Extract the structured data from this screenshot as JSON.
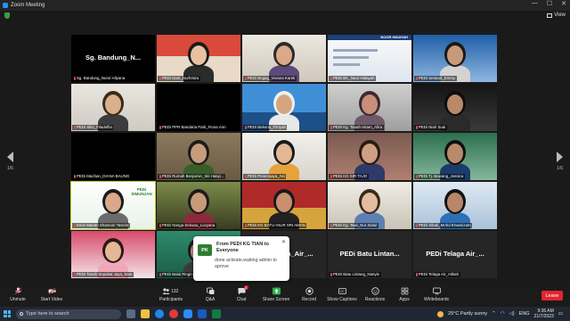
{
  "window": {
    "title": "Zoom Meeting",
    "controls": [
      "—",
      "☐",
      "✕"
    ]
  },
  "view_button": {
    "label": "View"
  },
  "pager": {
    "left": "1/6",
    "right": "1/6"
  },
  "tiles": [
    {
      "name": "Sg. Bandung_Nurul Hilyana",
      "big": "Sg. Bandung_N...",
      "muted": true,
      "video": false
    },
    {
      "name": "PEDi Darit_Nurhmira",
      "muted": true,
      "video": true
    },
    {
      "name": "PEDi Bogag_Viviana Karek",
      "muted": true,
      "video": true
    },
    {
      "name": "PEDi BC_Noor Hidayah",
      "muted": true,
      "video": true,
      "slide_title": "NOOR HIDAYAH"
    },
    {
      "name": "PEDi Serasot_Emmy",
      "muted": true,
      "video": true
    },
    {
      "name": "PEDi Sklo_Filadelfia",
      "muted": true,
      "video": true
    },
    {
      "name": "PEDi PPR Bandaria Park_Fiona Ann",
      "muted": true,
      "video": false
    },
    {
      "name": "PEDi Bekenu_Fitriyah",
      "muted": true,
      "video": true
    },
    {
      "name": "PEDi Kg. Tanah Hitam_Afira",
      "muted": true,
      "video": true
    },
    {
      "name": "PEDi Niah Suai",
      "muted": true,
      "video": true
    },
    {
      "name": "PEDi Machan_DIANA BAUNG",
      "muted": true,
      "video": false
    },
    {
      "name": "PEDi Rumah Benjamin_Siti Hasyi...",
      "muted": true,
      "video": true
    },
    {
      "name": "PEDi Pemenjaya_Asi",
      "muted": true,
      "video": true
    },
    {
      "name": "PEDi KG SIR TAJO",
      "muted": true,
      "video": true
    },
    {
      "name": "PEDi Tj. Bowang_Jessica",
      "muted": true,
      "video": true
    },
    {
      "name": "Irene Marian Shannon Tassim",
      "muted": true,
      "video": true,
      "active": true,
      "banner": "PEDi SIMUNJAN"
    },
    {
      "name": "PEDi Nanga Sekuau_Lucyana",
      "muted": true,
      "video": true
    },
    {
      "name": "PEDi KG BATU HILIR SRI AMAN",
      "muted": true,
      "video": true
    },
    {
      "name": "PEDi Kg. Tawi_Nur Zaitul",
      "muted": true,
      "video": true
    },
    {
      "name": "PEDi Sibuti_Mohd Erwanizam",
      "muted": true,
      "video": true
    },
    {
      "name": "PEDi Tanah Sepakat Jaya_Sam",
      "muted": true,
      "video": true
    },
    {
      "name": "PEDi Balai Ringin",
      "muted": true,
      "video": true
    },
    {
      "name": "PEDi Kuala_Air_...",
      "big": "PEDi Kuala_Air_...",
      "muted": true,
      "video": false
    },
    {
      "name": "PEDi Batu Lintang_Nanyie",
      "big": "PEDi Batu Lintan...",
      "muted": true,
      "video": false
    },
    {
      "name": "PEDi Telaga Air_Atikah",
      "big": "PEDi Telaga Air_...",
      "muted": true,
      "video": false
    }
  ],
  "chat_popup": {
    "initials": "PK",
    "from": "From PEDI KG TIAN to Everyone",
    "message": "done activate,waiting admin to aprove"
  },
  "toolbar": {
    "unmute": "Unmute",
    "start_video": "Start Video",
    "participants": "Participants",
    "participants_count": "132",
    "qa": "Q&A",
    "chat": "Chat",
    "chat_badge": "3",
    "share": "Share Screen",
    "record": "Record",
    "captions": "Show Captions",
    "reactions": "Reactions",
    "apps": "Apps",
    "whiteboards": "Whiteboards",
    "leave": "Leave"
  },
  "taskbar": {
    "search_placeholder": "Type here to search",
    "weather": "25°C  Partly sunny",
    "language": "ENG",
    "time": "9:36 AM",
    "date": "21/7/2023"
  },
  "colors": {
    "accent": "#2d8cff",
    "leave": "#e0262f",
    "active_speaker": "#b6d33b",
    "share": "#2eb04d"
  }
}
